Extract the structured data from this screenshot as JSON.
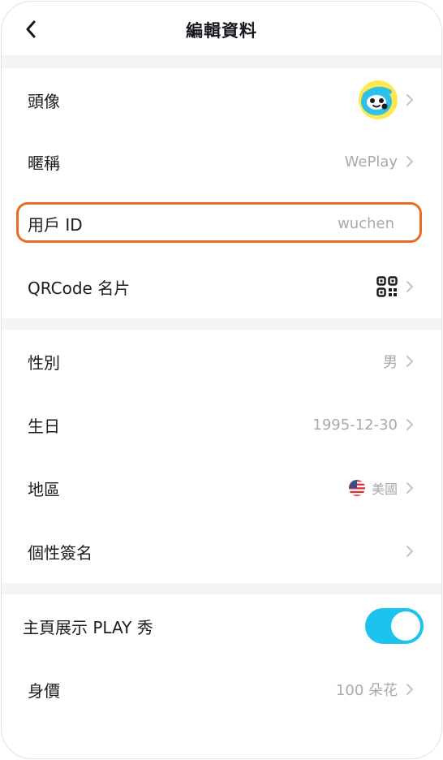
{
  "header": {
    "title": "編輯資料"
  },
  "section1": {
    "avatar": {
      "label": "頭像"
    },
    "nickname": {
      "label": "暱稱",
      "value": "WePlay"
    },
    "user_id": {
      "label": "用戶 ID",
      "value": "wuchen"
    },
    "qrcode": {
      "label": "QRCode 名片"
    }
  },
  "section2": {
    "gender": {
      "label": "性別",
      "value": "男"
    },
    "birthday": {
      "label": "生日",
      "value": "1995-12-30"
    },
    "region": {
      "label": "地區",
      "value": "美國",
      "flag_icon": "us-flag-icon"
    },
    "signature": {
      "label": "個性簽名"
    }
  },
  "section3": {
    "show_play": {
      "label": "主頁展示 PLAY 秀",
      "enabled": true
    },
    "worth": {
      "label": "身價",
      "value": "100 朵花"
    }
  },
  "colors": {
    "accent": "#1cc3ef",
    "highlight": "#ec6a24",
    "text": "#1b1c21",
    "secondary_text": "#a8a8b0",
    "divider": "#f5f5f7"
  }
}
